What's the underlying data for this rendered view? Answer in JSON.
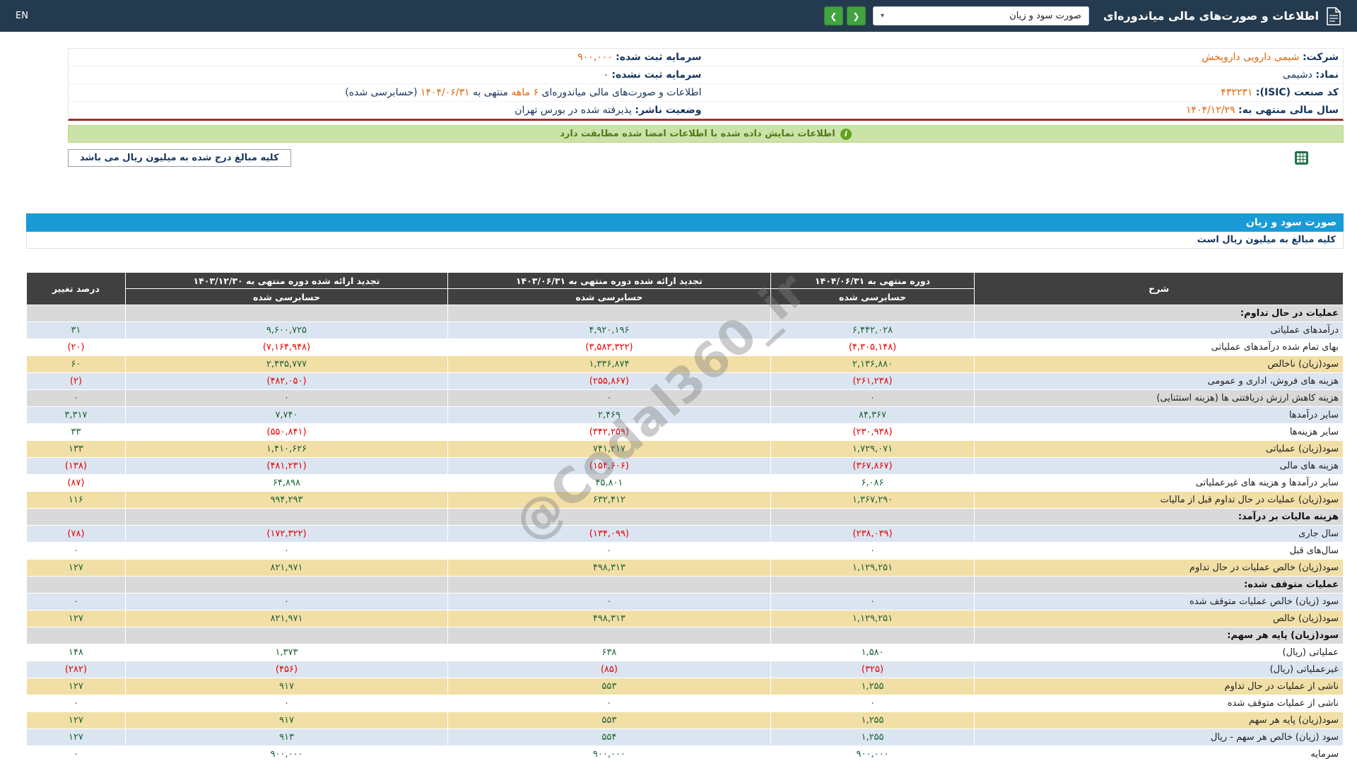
{
  "topbar": {
    "title": "اطلاعات و صورت‌های مالی میاندوره‌ای",
    "report_dropdown": {
      "value": "صورت سود و زیان",
      "caret": "▾"
    },
    "nav_back_glyph": "❮",
    "nav_forward_glyph": "❯",
    "lang": "EN"
  },
  "company": {
    "company_label": "شرکت:",
    "company_value": "شیمی دارویی داروپخش",
    "symbol_label": "نماد:",
    "symbol_value": "دشیمی",
    "isic_label": "کد صنعت (ISIC):",
    "isic_value": "۴۳۲۲۳۱",
    "fiscal_year_label": "سال مالی منتهی به:",
    "fiscal_year_value": "۱۴۰۴/۱۲/۲۹",
    "registered_capital_label": "سرمایه ثبت شده:",
    "registered_capital_value": "۹۰۰,۰۰۰",
    "unregistered_capital_label": "سرمایه ثبت نشده:",
    "unregistered_capital_value": "۰",
    "period_prefix": "اطلاعات و صورت‌های مالی میاندوره‌ای",
    "period_length": "۶ ماهه",
    "period_connector": "منتهی به",
    "period_date": "۱۴۰۴/۰۶/۳۱",
    "period_suffix": "(حسابرسی شده)",
    "status_label": "وضعیت ناشر:",
    "status_value": "پذیرفته شده در بورس تهران"
  },
  "signed_notice": "اطلاعات نمایش داده شده با اطلاعات امضا شده مطابقت دارد",
  "amount_note": "کلیه مبالغ درج شده به میلیون ریال می باشد",
  "statement": {
    "title": "صورت سود و زیان",
    "unit_note": "کلیه مبالغ به میلیون ریال است",
    "watermark": "@Codal360_ir",
    "columns": {
      "desc": "شرح",
      "current_period": "دوره منتهی به ۱۴۰۴/۰۶/۳۱",
      "restated_prior": "تجدید ارائه شده دوره منتهی به ۱۴۰۳/۰۶/۳۱",
      "restated_annual": "تجدید ارائه شده دوره منتهی به ۱۴۰۳/۱۲/۳۰",
      "audited": "حسابرسی شده",
      "change_pct": "درصد تغییر"
    },
    "rows": [
      {
        "label": "عملیات در حال تداوم:",
        "variant": "section",
        "values": [
          "",
          "",
          "",
          ""
        ]
      },
      {
        "label": "درآمدهای عملیاتی",
        "variant": "blue",
        "values": [
          "۶,۴۴۲,۰۲۸",
          "۴,۹۲۰,۱۹۶",
          "۹,۶۰۰,۷۲۵",
          "۳۱"
        ]
      },
      {
        "label": "بهای تمام شده درآمدهای عملیاتی",
        "variant": "white",
        "values": [
          "(۴,۳۰۵,۱۴۸)",
          "(۳,۵۸۳,۳۲۲)",
          "(۷,۱۶۴,۹۴۸)",
          "(۲۰)"
        ]
      },
      {
        "label": "سود(زیان) ناخالص",
        "variant": "tan",
        "values": [
          "۲,۱۳۶,۸۸۰",
          "۱,۳۳۶,۸۷۴",
          "۲,۴۳۵,۷۷۷",
          "۶۰"
        ]
      },
      {
        "label": "هزینه های فروش، اداری و عمومی",
        "variant": "blue",
        "values": [
          "(۲۶۱,۲۳۸)",
          "(۲۵۵,۸۶۷)",
          "(۴۸۲,۰۵۰)",
          "(۲)"
        ]
      },
      {
        "label": "هزینه کاهش ارزش دریافتنی ها (هزینه استثنایی)",
        "variant": "gray",
        "values": [
          "۰",
          "۰",
          "۰",
          "۰"
        ]
      },
      {
        "label": "سایر درآمدها",
        "variant": "blue",
        "values": [
          "۸۴,۳۶۷",
          "۲,۴۶۹",
          "۷,۷۴۰",
          "۳,۳۱۷"
        ]
      },
      {
        "label": "سایر هزینه‌ها",
        "variant": "white",
        "values": [
          "(۲۳۰,۹۳۸)",
          "(۳۴۲,۲۵۹)",
          "(۵۵۰,۸۴۱)",
          "۳۳"
        ]
      },
      {
        "label": "سود(زیان) عملیاتی",
        "variant": "tan",
        "values": [
          "۱,۷۲۹,۰۷۱",
          "۷۴۱,۲۱۷",
          "۱,۴۱۰,۶۲۶",
          "۱۳۳"
        ]
      },
      {
        "label": "هزینه های مالی",
        "variant": "blue",
        "values": [
          "(۳۶۷,۸۶۷)",
          "(۱۵۴,۶۰۶)",
          "(۴۸۱,۲۳۱)",
          "(۱۳۸)"
        ]
      },
      {
        "label": "سایر درآمدها و هزینه های غیرعملیاتی",
        "variant": "white",
        "values": [
          "۶,۰۸۶",
          "۴۵,۸۰۱",
          "۶۴,۸۹۸",
          "(۸۷)"
        ]
      },
      {
        "label": "سود(زیان) عملیات در حال تداوم قبل از مالیات",
        "variant": "tan",
        "values": [
          "۱,۳۶۷,۲۹۰",
          "۶۳۲,۴۱۲",
          "۹۹۴,۲۹۳",
          "۱۱۶"
        ]
      },
      {
        "label": "هزینه مالیات بر درآمد:",
        "variant": "section",
        "values": [
          "",
          "",
          "",
          ""
        ]
      },
      {
        "label": "سال جاری",
        "variant": "blue",
        "values": [
          "(۲۳۸,۰۳۹)",
          "(۱۳۴,۰۹۹)",
          "(۱۷۲,۳۲۲)",
          "(۷۸)"
        ]
      },
      {
        "label": "سال‌های قبل",
        "variant": "white",
        "values": [
          "۰",
          "۰",
          "۰",
          "۰"
        ]
      },
      {
        "label": "سود(زیان) خالص عملیات در حال تداوم",
        "variant": "tan",
        "values": [
          "۱,۱۲۹,۲۵۱",
          "۴۹۸,۳۱۳",
          "۸۲۱,۹۷۱",
          "۱۲۷"
        ]
      },
      {
        "label": "عملیات متوقف شده:",
        "variant": "section",
        "values": [
          "",
          "",
          "",
          ""
        ]
      },
      {
        "label": "سود (زیان) خالص عملیات متوقف شده",
        "variant": "blue",
        "values": [
          "۰",
          "۰",
          "۰",
          "۰"
        ]
      },
      {
        "label": "سود(زیان) خالص",
        "variant": "tan",
        "values": [
          "۱,۱۲۹,۲۵۱",
          "۴۹۸,۳۱۳",
          "۸۲۱,۹۷۱",
          "۱۲۷"
        ]
      },
      {
        "label": "سود(زیان) پایه هر سهم:",
        "variant": "section",
        "values": [
          "",
          "",
          "",
          ""
        ]
      },
      {
        "label": "عملیاتی (ریال)",
        "variant": "white",
        "values": [
          "۱,۵۸۰",
          "۶۳۸",
          "۱,۳۷۳",
          "۱۴۸"
        ]
      },
      {
        "label": "غیرعملیاتی (ریال)",
        "variant": "blue",
        "values": [
          "(۳۲۵)",
          "(۸۵)",
          "(۴۵۶)",
          "(۲۸۲)"
        ]
      },
      {
        "label": "ناشی از عملیات در حال تداوم",
        "variant": "tan",
        "values": [
          "۱,۲۵۵",
          "۵۵۳",
          "۹۱۷",
          "۱۲۷"
        ]
      },
      {
        "label": "ناشی از عملیات متوقف شده",
        "variant": "white",
        "values": [
          "۰",
          "۰",
          "۰",
          "۰"
        ]
      },
      {
        "label": "سود(زیان) پایه هر سهم",
        "variant": "tan",
        "values": [
          "۱,۲۵۵",
          "۵۵۳",
          "۹۱۷",
          "۱۲۷"
        ]
      },
      {
        "label": "سود (زیان) خالص هر سهم - ریال",
        "variant": "blue",
        "values": [
          "۱,۲۵۵",
          "۵۵۴",
          "۹۱۳",
          "۱۲۷"
        ]
      },
      {
        "label": "سرمایه",
        "variant": "white",
        "values": [
          "۹۰۰,۰۰۰",
          "۹۰۰,۰۰۰",
          "۹۰۰,۰۰۰",
          "۰"
        ]
      }
    ]
  }
}
